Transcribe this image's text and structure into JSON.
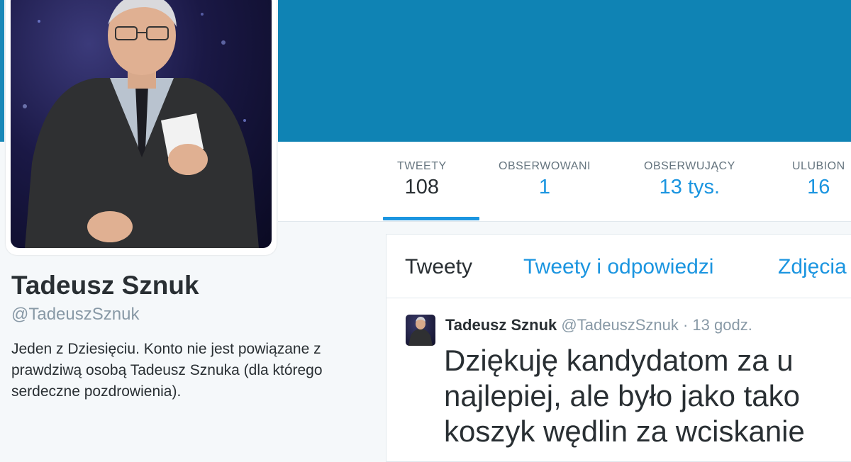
{
  "profile": {
    "name": "Tadeusz Sznuk",
    "handle": "@TadeuszSznuk",
    "bio": "Jeden z Dziesięciu. Konto nie jest powiązane z prawdziwą osobą Tadeusz Sznuka (dla którego serdeczne pozdrowienia).",
    "banner_color": "#0f83b4"
  },
  "stats": [
    {
      "label": "TWEETY",
      "value": "108",
      "active": true
    },
    {
      "label": "OBSERWOWANI",
      "value": "1",
      "active": false
    },
    {
      "label": "OBSERWUJĄCY",
      "value": "13 tys.",
      "active": false
    },
    {
      "label": "ULUBION",
      "value": "16",
      "active": false
    }
  ],
  "tabs": [
    {
      "label": "Tweety",
      "active": true
    },
    {
      "label": "Tweety i odpowiedzi",
      "active": false
    },
    {
      "label": "Zdjęcia",
      "active": false
    }
  ],
  "tweet": {
    "name": "Tadeusz Sznuk",
    "handle": "@TadeuszSznuk",
    "separator": "·",
    "time": "13 godz.",
    "lines": [
      "Dziękuję kandydatom za u",
      "najlepiej, ale było jako tako",
      "koszyk wędlin za wciskanie"
    ]
  },
  "colors": {
    "link": "#1b95e0",
    "text": "#292f33",
    "muted": "#8899a6"
  }
}
